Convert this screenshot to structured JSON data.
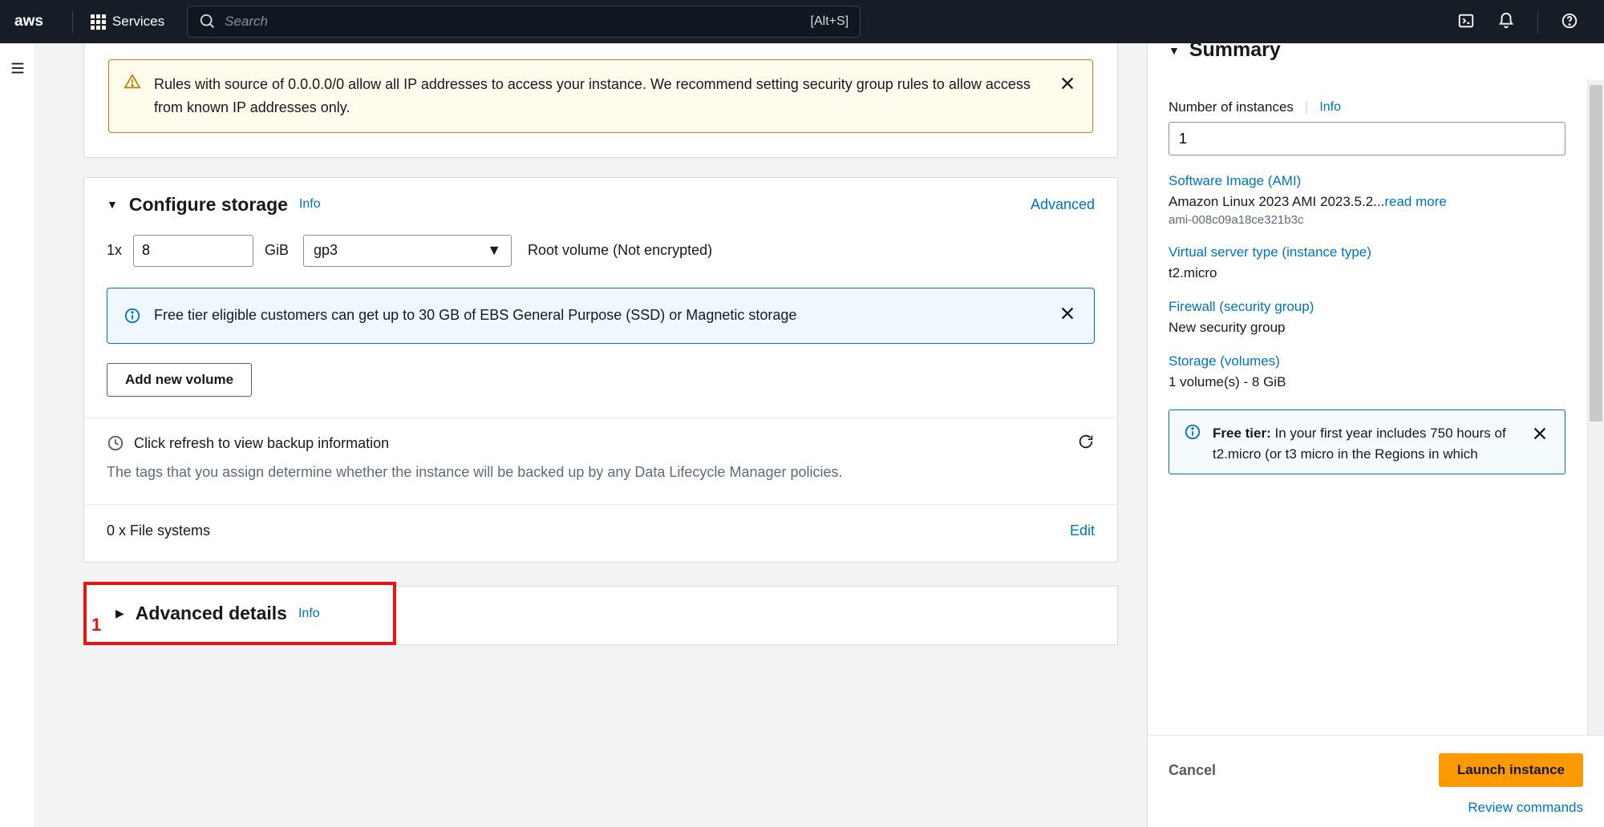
{
  "topnav": {
    "logo_text": "aws",
    "services_label": "Services",
    "search_placeholder": "Search",
    "search_shortcut": "[Alt+S]"
  },
  "warning": {
    "text": "Rules with source of 0.0.0.0/0 allow all IP addresses to access your instance. We recommend setting security group rules to allow access from known IP addresses only."
  },
  "storage": {
    "header": "Configure storage",
    "info_label": "Info",
    "advanced_label": "Advanced",
    "multiplier": "1x",
    "size_value": "8",
    "size_unit": "GiB",
    "type_value": "gp3",
    "volume_desc": "Root volume  (Not encrypted)",
    "free_tier_msg": "Free tier eligible customers can get up to 30 GB of EBS General Purpose (SSD) or Magnetic storage",
    "add_volume_label": "Add new volume",
    "backup_refresh": "Click refresh to view backup information",
    "backup_desc": "The tags that you assign determine whether the instance will be backed up by any Data Lifecycle Manager policies.",
    "fs_text": "0 x File systems",
    "edit_label": "Edit"
  },
  "advanced": {
    "header": "Advanced details",
    "info_label": "Info",
    "marker": "1"
  },
  "summary": {
    "title": "Summary",
    "num_instances_label": "Number of instances",
    "info_label": "Info",
    "num_instances_value": "1",
    "ami_label": "Software Image (AMI)",
    "ami_value": "Amazon Linux 2023 AMI 2023.5.2...",
    "read_more": "read more",
    "ami_id": "ami-008c09a18ce321b3c",
    "itype_label": "Virtual server type (instance type)",
    "itype_value": "t2.micro",
    "fw_label": "Firewall (security group)",
    "fw_value": "New security group",
    "storage_label": "Storage (volumes)",
    "storage_value": "1 volume(s) - 8 GiB",
    "freetier_bold": "Free tier:",
    "freetier_msg": " In your first year includes 750 hours of t2.micro (or t3 micro in the Regions in which",
    "cancel_label": "Cancel",
    "launch_label": "Launch instance",
    "review_label": "Review commands"
  }
}
